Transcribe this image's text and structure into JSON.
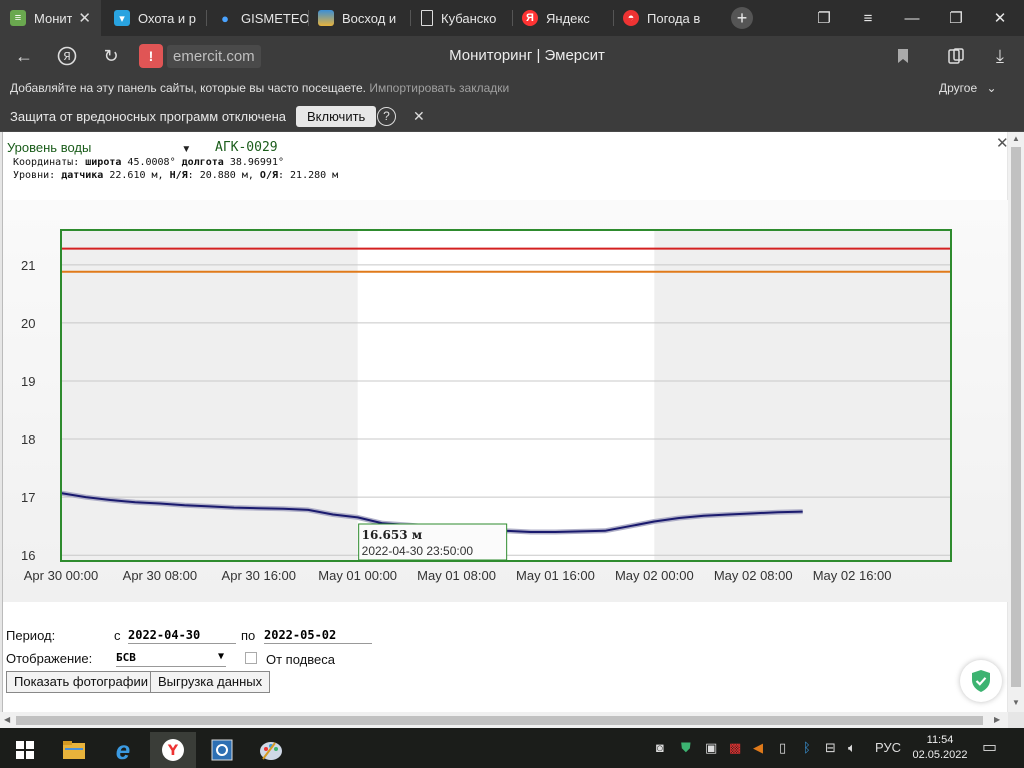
{
  "browser": {
    "tabs": [
      {
        "label": "Монит",
        "icon": "monitoring-favicon-icon",
        "active": true
      },
      {
        "label": "Охота и р",
        "icon": "chat-favicon-icon"
      },
      {
        "label": "GISMETEO",
        "icon": "gismeteo-drop-icon"
      },
      {
        "label": "Восход и",
        "icon": "sunrise-favicon-icon"
      },
      {
        "label": "Кубанско",
        "icon": "document-favicon-icon"
      },
      {
        "label": "Яндекс",
        "icon": "yandex-favicon-icon"
      },
      {
        "label": "Погода в",
        "icon": "weather-favicon-icon"
      }
    ],
    "url": "emercit.com",
    "page_title": "Мониторинг | Эмерсит",
    "bookmarks_hint": "Добавляйте на эту панель сайты, которые вы часто посещаете.",
    "import_bookmarks": "Импортировать закладки",
    "other_label": "Другое",
    "protection_msg": "Защита от вредоносных программ отключена",
    "enable_label": "Включить",
    "help_label": "?"
  },
  "panel": {
    "parameter": "Уровень воды",
    "station": "АГК-0029",
    "coords_label": "Координаты:",
    "lat_label": "широта",
    "lat_value": "45.0008°",
    "lon_label": "долгота",
    "lon_value": "38.96991°",
    "levels_label": "Уровни:",
    "sensor_label": "датчика",
    "sensor_value": "22.610 м,",
    "ny_label": "Н/Я",
    "ny_value": "20.880 м,",
    "oy_label": "О/Я",
    "oy_value": "21.280 м"
  },
  "chart_data": {
    "type": "line",
    "title": "",
    "xlabel": "",
    "ylabel": "",
    "ylim": [
      15.9,
      21.6
    ],
    "yticks": [
      16,
      17,
      18,
      19,
      20,
      21
    ],
    "x_tick_labels": [
      "Apr 30 00:00",
      "Apr 30 08:00",
      "Apr 30 16:00",
      "May 01 00:00",
      "May 01 08:00",
      "May 01 16:00",
      "May 02 00:00",
      "May 02 08:00",
      "May 02 16:00"
    ],
    "x_tick_hours": [
      0,
      8,
      16,
      24,
      32,
      40,
      48,
      56,
      64
    ],
    "xlim_hours": [
      0,
      72
    ],
    "grid": true,
    "shaded_bands_hours": [
      [
        0,
        24
      ],
      [
        48,
        72
      ]
    ],
    "thresholds": [
      {
        "value": 21.28,
        "color": "#d42020"
      },
      {
        "value": 20.88,
        "color": "#e07a1a"
      }
    ],
    "series": [
      {
        "color": "#1a1a6e",
        "x_hours": [
          0,
          2,
          4,
          6,
          8,
          10,
          12,
          14,
          16,
          18,
          20,
          22,
          24,
          26,
          28,
          30,
          32,
          34,
          36,
          38,
          40,
          42,
          44,
          46,
          48,
          50,
          52,
          54,
          56,
          58,
          60
        ],
        "y": [
          17.07,
          17.0,
          16.95,
          16.91,
          16.89,
          16.86,
          16.84,
          16.82,
          16.81,
          16.8,
          16.78,
          16.7,
          16.65,
          16.55,
          16.52,
          16.48,
          16.44,
          16.43,
          16.42,
          16.4,
          16.4,
          16.41,
          16.42,
          16.5,
          16.58,
          16.64,
          16.68,
          16.7,
          16.72,
          16.74,
          16.75
        ]
      }
    ],
    "tooltip": {
      "value": "16.653 м",
      "time": "2022-04-30 23:50:00"
    }
  },
  "form": {
    "period_label": "Период:",
    "from_label": "с",
    "from_value": "2022-04-30",
    "to_label": "по",
    "to_value": "2022-05-02",
    "display_label": "Отображение:",
    "display_value": "БСВ",
    "suspension_label": "От подвеса",
    "photos_button": "Показать фотографии",
    "export_button": "Выгрузка данных"
  },
  "taskbar": {
    "lang": "РУС",
    "time": "11:54",
    "date": "02.05.2022"
  }
}
